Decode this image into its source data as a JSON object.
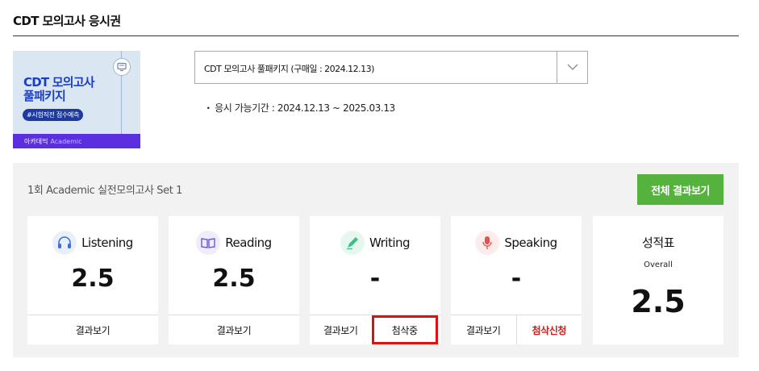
{
  "page": {
    "title": "CDT 모의고사 응시권"
  },
  "thumbnail": {
    "title_line1": "CDT 모의고사",
    "title_line2": "풀패키지",
    "badge": "#시험직전 점수예측",
    "footer_brand": "아카데믹",
    "footer_sub": "Academic",
    "icon": "monitor-icon"
  },
  "product_select": {
    "selected": "CDT 모의고사 풀패키지 (구매일 : 2024.12.13)",
    "arrow_icon": "chevron-down-icon"
  },
  "period": {
    "bullet": "·",
    "text": "응시 가능기간 : 2024.12.13 ~ 2025.03.13"
  },
  "results": {
    "set_title": "1회 Academic 실전모의고사 Set 1",
    "view_all_label": "전체 결과보기",
    "sections": [
      {
        "name": "Listening",
        "score": "2.5",
        "icon": "headphones-icon",
        "icon_color": "#3f6fd8",
        "icon_bg": "#eaf0fb",
        "result_label": "결과보기"
      },
      {
        "name": "Reading",
        "score": "2.5",
        "icon": "book-icon",
        "icon_color": "#6a5bd0",
        "icon_bg": "#efedfb",
        "result_label": "결과보기"
      },
      {
        "name": "Writing",
        "score": "-",
        "icon": "pen-icon",
        "icon_color": "#3cc08a",
        "icon_bg": "#e7f7ef",
        "result_label": "결과보기",
        "extra_label": "첨삭중"
      },
      {
        "name": "Speaking",
        "score": "-",
        "icon": "microphone-icon",
        "icon_color": "#e0524f",
        "icon_bg": "#fcecec",
        "result_label": "결과보기",
        "extra_label": "첨삭신청"
      }
    ],
    "report": {
      "title": "성적표",
      "subtitle": "Overall",
      "score": "2.5"
    }
  },
  "colors": {
    "accent_green": "#55b33d",
    "alert_red": "#d11a1a",
    "panel_bg": "#f2f2f2"
  }
}
